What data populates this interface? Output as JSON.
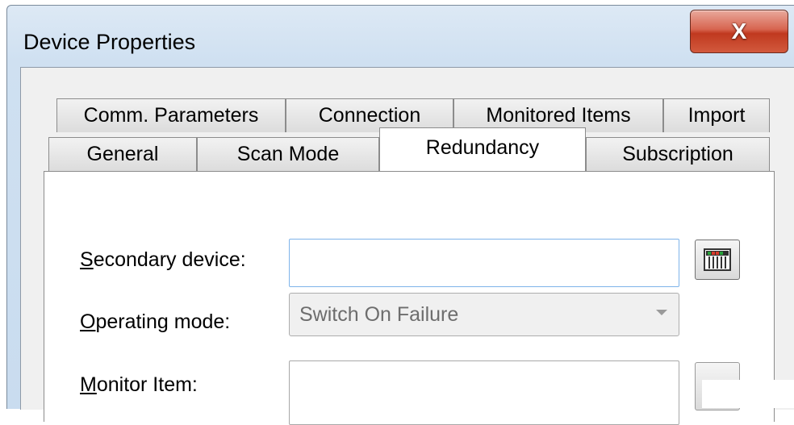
{
  "window": {
    "title": "Device Properties",
    "close_icon": "close-x-icon",
    "close_button_color": "#c7472b"
  },
  "tabs": {
    "back_row": [
      "Comm. Parameters",
      "Connection",
      "Monitored Items",
      "Import"
    ],
    "front_row": [
      "General",
      "Scan Mode",
      "Redundancy",
      "Subscription"
    ],
    "active": "Redundancy"
  },
  "redundancy": {
    "secondary_device": {
      "label_mnemonic": "S",
      "label_rest": "econdary device:",
      "value": "",
      "browse_icon": "device-browse-icon"
    },
    "operating_mode": {
      "label_mnemonic": "O",
      "label_rest": "perating mode:",
      "selected": "Switch On Failure",
      "icon": "chevron-down-icon"
    },
    "monitor_item": {
      "label_mnemonic": "M",
      "label_rest": "onitor Item:",
      "value": ""
    }
  }
}
